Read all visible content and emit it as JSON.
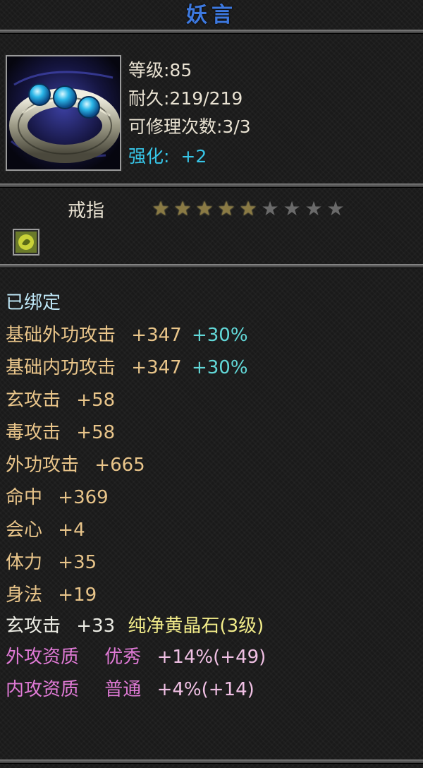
{
  "item": {
    "name": "妖言",
    "level_text": "等级:85",
    "durability_text": "耐久:219/219",
    "repair_text": "可修理次数:3/3",
    "enhance_label": "强化:",
    "enhance_value": "+2",
    "type": "戒指",
    "stars": {
      "filled": 5,
      "total": 9
    },
    "icon": "ring-icon",
    "gem_slot_icon": "gem-slot-icon"
  },
  "stats": {
    "bound": "已绑定",
    "base_ext_label": "基础外功攻击",
    "base_ext_value": "+347",
    "base_ext_pct": "+30%",
    "base_int_label": "基础内功攻击",
    "base_int_value": "+347",
    "base_int_pct": "+30%",
    "xuan_label": "玄攻击",
    "xuan_value": "+58",
    "du_label": "毒攻击",
    "du_value": "+58",
    "wai_label": "外功攻击",
    "wai_value": "+665",
    "mingzhong_label": "命中",
    "mingzhong_value": "+369",
    "huixin_label": "会心",
    "huixin_value": "+4",
    "tili_label": "体力",
    "tili_value": "+35",
    "shenfa_label": "身法",
    "shenfa_value": "+19"
  },
  "gem": {
    "attr_label": "玄攻击",
    "attr_value": "+33",
    "gem_name": "纯净黄晶石(3级)"
  },
  "aptitude": {
    "ext_label": "外攻资质",
    "ext_grade": "优秀",
    "ext_value": "+14%(+49)",
    "int_label": "内攻资质",
    "int_grade": "普通",
    "int_value": "+4%(+14)"
  },
  "colors": {
    "title": "#3d79e0",
    "enhance": "#37c6e8",
    "attribute": "#e9c58a",
    "percent": "#62d8d8",
    "gem": "#f2ec8a",
    "aptitude": "#e07ad6"
  }
}
